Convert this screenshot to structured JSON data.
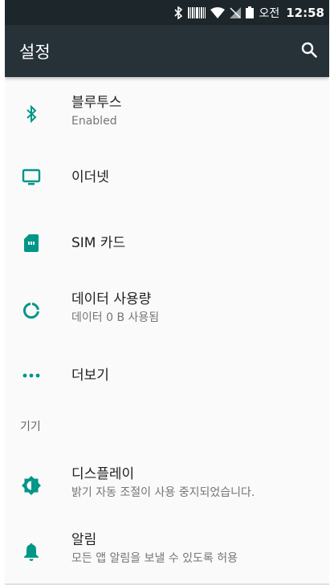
{
  "status_bar": {
    "time": "12:58",
    "ampm": "오전",
    "icons": [
      "bluetooth-icon",
      "barcode-icon",
      "wifi-icon",
      "no-sim-icon",
      "battery-icon"
    ]
  },
  "toolbar": {
    "title": "설정",
    "search_icon": "search-icon"
  },
  "items": [
    {
      "title": "블루투스",
      "subtitle": "Enabled",
      "icon": "bluetooth-icon"
    },
    {
      "title": "이더넷",
      "subtitle": "",
      "icon": "monitor-icon"
    },
    {
      "title": "SIM 카드",
      "subtitle": "",
      "icon": "sim-card-icon"
    },
    {
      "title": "데이터 사용량",
      "subtitle": "데이터 0 B 사용됨",
      "icon": "data-usage-icon"
    },
    {
      "title": "더보기",
      "subtitle": "",
      "icon": "more-dots-icon"
    }
  ],
  "section_label": "기기",
  "device_items": [
    {
      "title": "디스플레이",
      "subtitle": "밝기 자동 조절이 사용 중지되었습니다.",
      "icon": "brightness-icon"
    },
    {
      "title": "알림",
      "subtitle": "모든 앱 알림을 보낼 수 있도록 허용",
      "icon": "bell-icon"
    }
  ],
  "colors": {
    "accent": "#009688",
    "toolbar": "#263238",
    "statusbar": "#1d262a"
  }
}
